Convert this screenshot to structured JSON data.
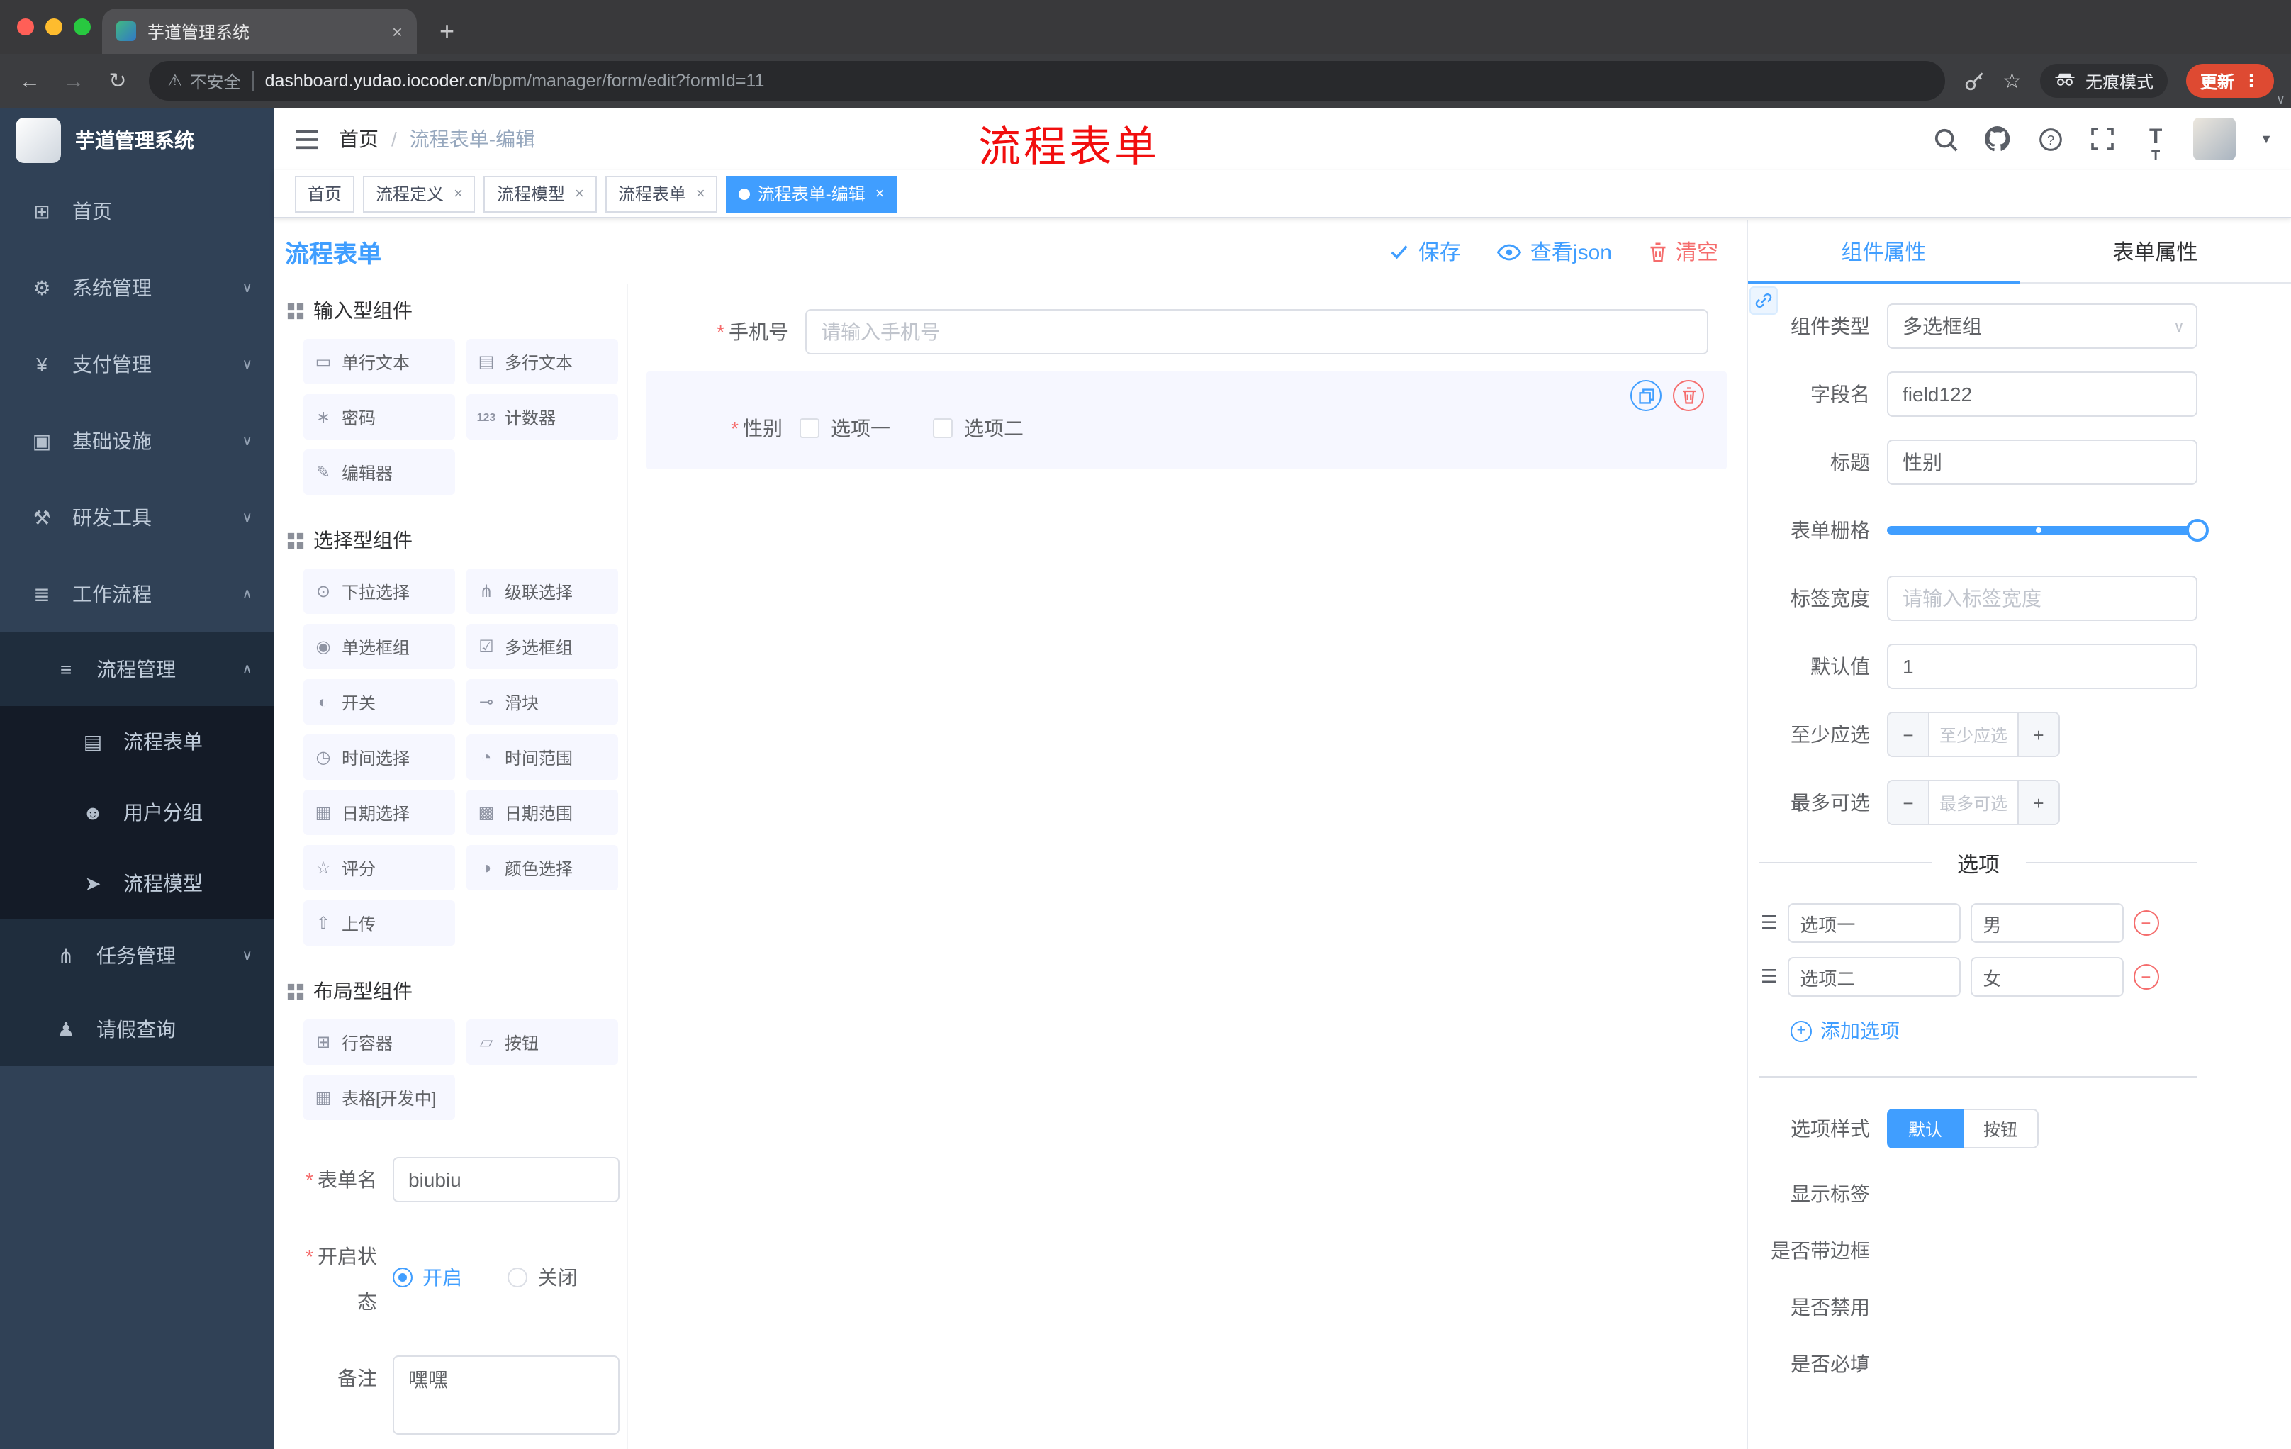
{
  "browser": {
    "tab_title": "芋道管理系统",
    "security_label": "不安全",
    "url_domain": "dashboard.yudao.iocoder.cn",
    "url_path": "/bpm/manager/form/edit?formId=11",
    "incognito_label": "无痕模式",
    "update_label": "更新"
  },
  "sidebar": {
    "app_title": "芋道管理系统",
    "items": [
      {
        "label": "首页"
      },
      {
        "label": "系统管理"
      },
      {
        "label": "支付管理"
      },
      {
        "label": "基础设施"
      },
      {
        "label": "研发工具"
      },
      {
        "label": "工作流程"
      },
      {
        "label": "流程管理"
      },
      {
        "label": "流程表单"
      },
      {
        "label": "用户分组"
      },
      {
        "label": "流程模型"
      },
      {
        "label": "任务管理"
      },
      {
        "label": "请假查询"
      }
    ]
  },
  "header": {
    "breadcrumb_home": "首页",
    "breadcrumb_current": "流程表单-编辑",
    "annotation": "流程表单"
  },
  "tags": [
    {
      "label": "首页"
    },
    {
      "label": "流程定义"
    },
    {
      "label": "流程模型"
    },
    {
      "label": "流程表单"
    },
    {
      "label": "流程表单-编辑"
    }
  ],
  "builder": {
    "title": "流程表单",
    "save_label": "保存",
    "view_json_label": "查看json",
    "clear_label": "清空",
    "groups": [
      {
        "title": "输入型组件",
        "items": [
          "单行文本",
          "多行文本",
          "密码",
          "计数器",
          "编辑器"
        ]
      },
      {
        "title": "选择型组件",
        "items": [
          "下拉选择",
          "级联选择",
          "单选框组",
          "多选框组",
          "开关",
          "滑块",
          "时间选择",
          "时间范围",
          "日期选择",
          "日期范围",
          "评分",
          "颜色选择",
          "上传"
        ]
      },
      {
        "title": "布局型组件",
        "items": [
          "行容器",
          "按钮",
          "表格[开发中]"
        ]
      }
    ],
    "meta": {
      "name_label": "表单名",
      "name_value": "biubiu",
      "status_label": "开启状态",
      "status_on": "开启",
      "status_off": "关闭",
      "remark_label": "备注",
      "remark_value": "嘿嘿"
    }
  },
  "canvas": {
    "phone_label": "手机号",
    "phone_placeholder": "请输入手机号",
    "gender_label": "性别",
    "gender_option1": "选项一",
    "gender_option2": "选项二"
  },
  "props": {
    "tab_component": "组件属性",
    "tab_form": "表单属性",
    "rows": {
      "type_label": "组件类型",
      "type_value": "多选框组",
      "field_label": "字段名",
      "field_value": "field122",
      "title_label": "标题",
      "title_value": "性别",
      "grid_label": "表单栅格",
      "labelw_label": "标签宽度",
      "labelw_placeholder": "请输入标签宽度",
      "default_label": "默认值",
      "default_value": "1",
      "min_label": "至少应选",
      "min_placeholder": "至少应选",
      "max_label": "最多可选",
      "max_placeholder": "最多可选"
    },
    "options_title": "选项",
    "options": [
      {
        "label": "选项一",
        "value": "男"
      },
      {
        "label": "选项二",
        "value": "女"
      }
    ],
    "add_option": "添加选项",
    "style_label": "选项样式",
    "style_default": "默认",
    "style_button": "按钮",
    "switch_show_label": "显示标签",
    "switch_border": "是否带边框",
    "switch_disabled": "是否禁用",
    "switch_required": "是否必填"
  },
  "colors": {
    "primary": "#409EFF",
    "danger": "#F56C6C",
    "annotation_red": "#F10E0E",
    "sidebar_bg": "#304156",
    "submenu_bg": "#1F2D3D",
    "subsubmenu_bg": "#141B27",
    "update_button": "#DE4A32"
  }
}
